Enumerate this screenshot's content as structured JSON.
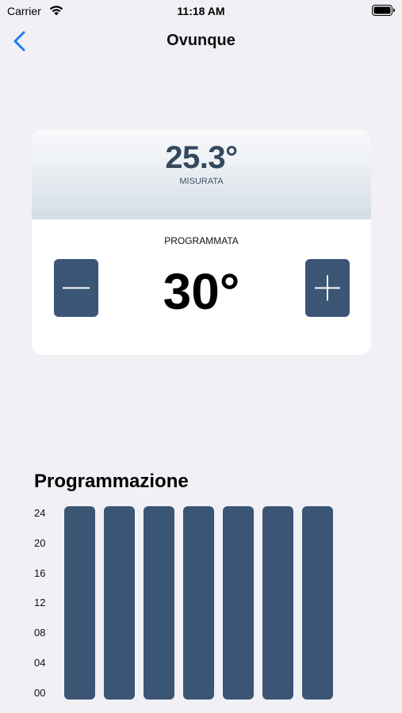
{
  "status_bar": {
    "carrier": "Carrier",
    "time": "11:18 AM",
    "wifi_icon": "wifi-icon",
    "battery_icon": "battery-icon"
  },
  "nav": {
    "back_icon": "chevron-left-icon",
    "title": "Ovunque"
  },
  "thermostat": {
    "measured_value": "25.3°",
    "measured_label": "MISURATA",
    "programmed_label": "PROGRAMMATA",
    "programmed_value": "30°",
    "decrement_icon": "minus-icon",
    "increment_icon": "plus-icon"
  },
  "schedule": {
    "title": "Programmazione",
    "y_ticks": [
      "24",
      "20",
      "16",
      "12",
      "08",
      "04",
      "00"
    ],
    "day_count": 7
  },
  "colors": {
    "accent": "#3b5575",
    "measured_text": "#34495e",
    "back_chevron": "#1e7bf0",
    "background": "#f0f0f5"
  }
}
